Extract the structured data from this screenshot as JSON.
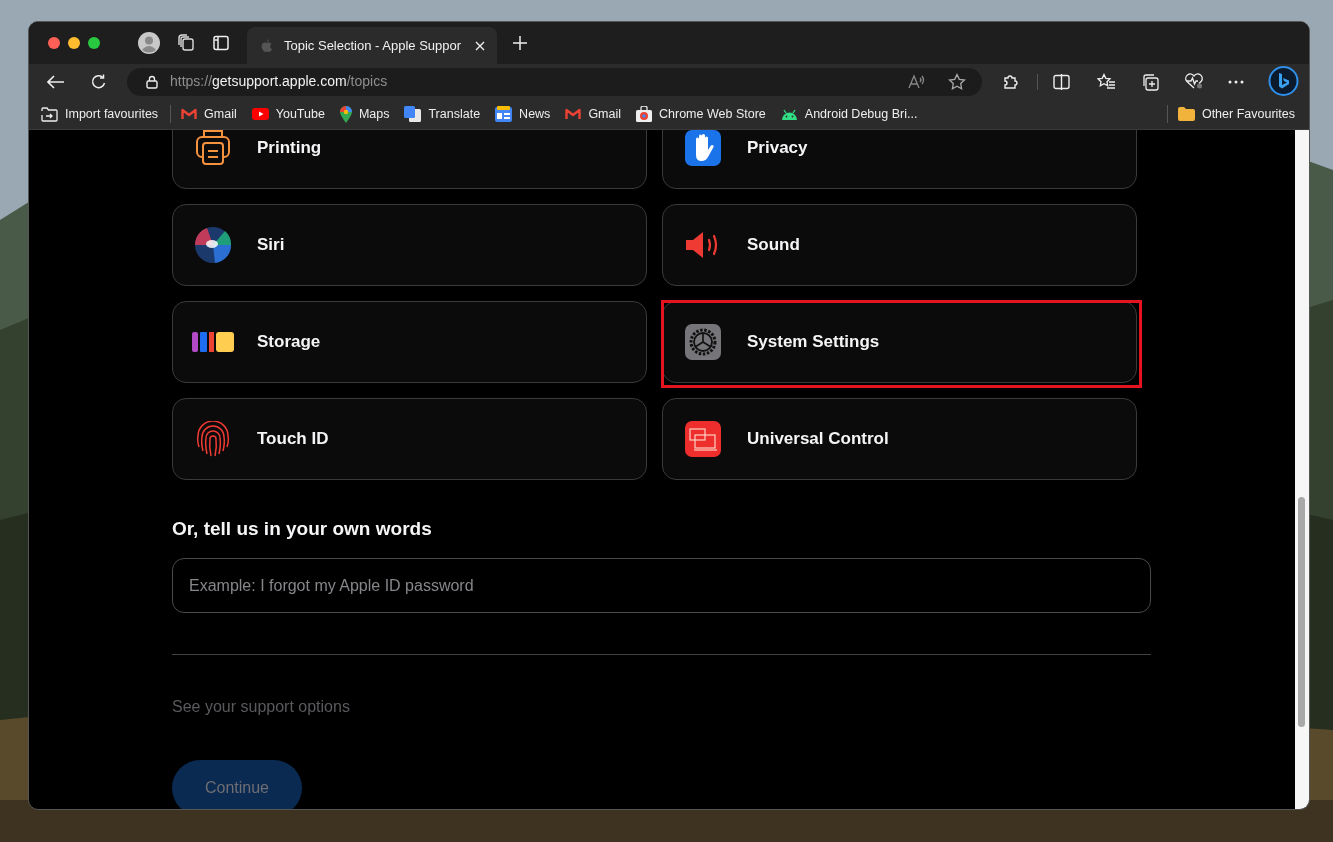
{
  "browser": {
    "tabs": [
      {
        "title": "Topic Selection - Apple Suppor",
        "selected": true
      }
    ],
    "address": {
      "scheme": "https://",
      "host": "getsupport.apple.com",
      "path": "/topics"
    },
    "bookmarks": [
      {
        "label": "Import favourites",
        "kind": "import"
      },
      {
        "label": "Gmail",
        "kind": "gmail"
      },
      {
        "label": "YouTube",
        "kind": "youtube"
      },
      {
        "label": "Maps",
        "kind": "maps"
      },
      {
        "label": "Translate",
        "kind": "translate"
      },
      {
        "label": "News",
        "kind": "news"
      },
      {
        "label": "Gmail",
        "kind": "gmail"
      },
      {
        "label": "Chrome Web Store",
        "kind": "store"
      },
      {
        "label": "Android Debug Bri...",
        "kind": "android"
      }
    ],
    "other_bookmarks": "Other Favourites"
  },
  "topics": [
    {
      "label": "Printing",
      "kind": "printer",
      "highlighted": false
    },
    {
      "label": "Privacy",
      "kind": "hand",
      "highlighted": false
    },
    {
      "label": "Siri",
      "kind": "siri",
      "highlighted": false
    },
    {
      "label": "Sound",
      "kind": "speaker",
      "highlighted": false
    },
    {
      "label": "Storage",
      "kind": "storage",
      "highlighted": false
    },
    {
      "label": "System Settings",
      "kind": "gear",
      "highlighted": true
    },
    {
      "label": "Touch ID",
      "kind": "fingerprint",
      "highlighted": false
    },
    {
      "label": "Universal Control",
      "kind": "screens",
      "highlighted": false
    }
  ],
  "own_words": {
    "heading": "Or, tell us in your own words",
    "placeholder": "Example: I forgot my Apple ID password"
  },
  "support_options": "See your support options",
  "continue_button": {
    "label": "Continue",
    "disabled": true
  }
}
